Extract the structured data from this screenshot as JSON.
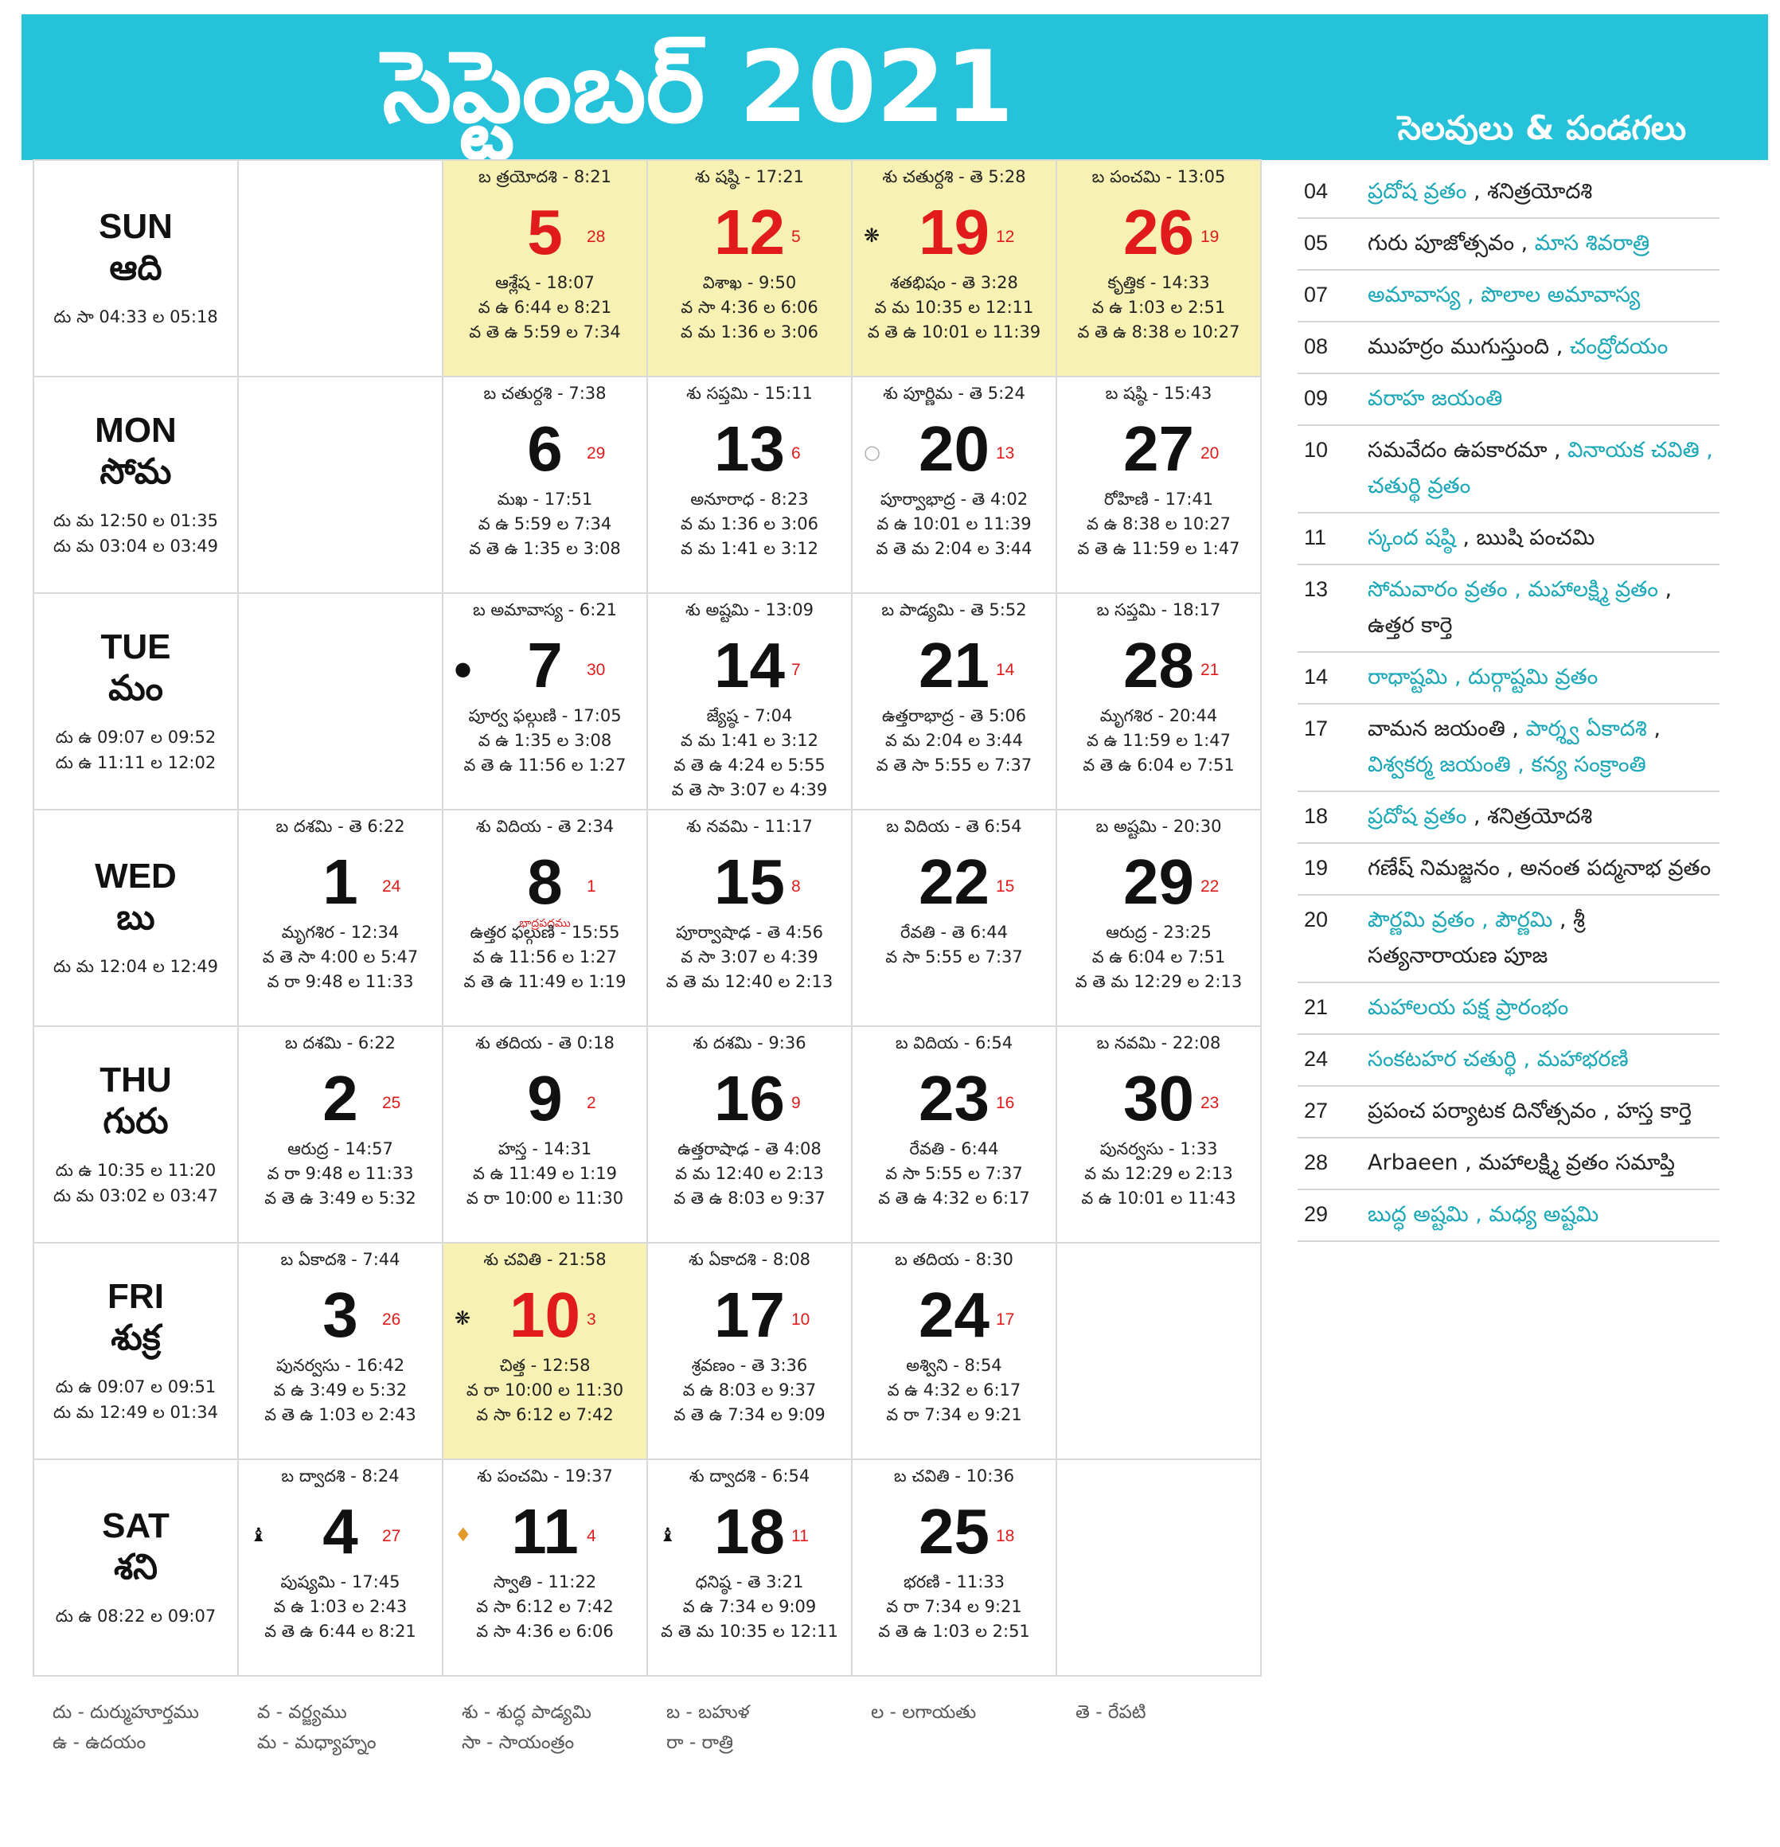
{
  "header": {
    "title": "సెప్టెంబర్ 2021",
    "subtitle": "సెలవులు & పండగలు"
  },
  "weekdays": [
    {
      "en": "SUN",
      "te": "ఆది",
      "durmuhurtham": [
        "దు సా 04:33 ల 05:18"
      ]
    },
    {
      "en": "MON",
      "te": "సోమ",
      "durmuhurtham": [
        "దు మ 12:50 ల 01:35",
        "దు మ 03:04 ల 03:49"
      ]
    },
    {
      "en": "TUE",
      "te": "మం",
      "durmuhurtham": [
        "దు ఉ 09:07 ల 09:52",
        "దు ఉ 11:11 ల 12:02"
      ]
    },
    {
      "en": "WED",
      "te": "బు",
      "durmuhurtham": [
        "దు మ 12:04 ల 12:49"
      ]
    },
    {
      "en": "THU",
      "te": "గురు",
      "durmuhurtham": [
        "దు ఉ 10:35 ల 11:20",
        "దు మ 03:02 ల 03:47"
      ]
    },
    {
      "en": "FRI",
      "te": "శుక్ర",
      "durmuhurtham": [
        "దు ఉ 09:07 ల 09:51",
        "దు మ 12:49 ల 01:34"
      ]
    },
    {
      "en": "SAT",
      "te": "శని",
      "durmuhurtham": [
        "దు ఉ 08:22 ల 09:07"
      ]
    }
  ],
  "days": [
    {
      "day": "1",
      "sub": "24",
      "tithi": "బ దశమి - తె 6:22",
      "lines": [
        "మృగశిర - 12:34",
        "వ తె సా 4:00 ల 5:47",
        "వ రా 9:48 ల 11:33"
      ]
    },
    {
      "day": "2",
      "sub": "25",
      "tithi": "బ దశమి - 6:22",
      "lines": [
        "ఆరుద్ర - 14:57",
        "వ రా 9:48 ల 11:33",
        "వ తె ఉ 3:49 ల 5:32"
      ]
    },
    {
      "day": "3",
      "sub": "26",
      "tithi": "బ ఏకాదశి - 7:44",
      "lines": [
        "పునర్వసు - 16:42",
        "వ ఉ 3:49 ల 5:32",
        "వ తె ఉ 1:03 ల 2:43"
      ]
    },
    {
      "day": "4",
      "sub": "27",
      "tithi": "బ ద్వాదశి - 8:24",
      "lines": [
        "పుష్యమి - 17:45",
        "వ ఉ 1:03 ల 2:43",
        "వ తె ఉ 6:44 ల 8:21"
      ],
      "symbol": "♝"
    },
    {
      "day": "5",
      "sub": "28",
      "tithi": "బ త్రయోదశి - 8:21",
      "lines": [
        "ఆశ్లేష - 18:07",
        "వ ఉ 6:44 ల 8:21",
        "వ తె ఉ 5:59 ల 7:34"
      ]
    },
    {
      "day": "6",
      "sub": "29",
      "tithi": "బ చతుర్దశి - 7:38",
      "lines": [
        "మఖ - 17:51",
        "వ ఉ 5:59 ల 7:34",
        "వ తె ఉ 1:35 ల 3:08"
      ]
    },
    {
      "day": "7",
      "sub": "30",
      "tithi": "బ అమావాస్య - 6:21",
      "lines": [
        "పూర్వ ఫల్గుణి - 17:05",
        "వ ఉ 1:35 ల 3:08",
        "వ తె ఉ 11:56 ల 1:27"
      ],
      "symbol": "●"
    },
    {
      "day": "8",
      "sub": "1",
      "tithi": "శు విదియ - తె 2:34",
      "note": "భాద్రపదము",
      "lines": [
        "ఉత్తర ఫల్గుణి - 15:55",
        "వ ఉ 11:56 ల 1:27",
        "వ తె ఉ 11:49 ల 1:19"
      ]
    },
    {
      "day": "9",
      "sub": "2",
      "tithi": "శు తదియ - తె 0:18",
      "lines": [
        "హస్త - 14:31",
        "వ ఉ 11:49 ల 1:19",
        "వ రా 10:00 ల 11:30"
      ]
    },
    {
      "day": "10",
      "sub": "3",
      "tithi": "శు చవితి - 21:58",
      "lines": [
        "చిత్త - 12:58",
        "వ రా 10:00 ల 11:30",
        "వ సా 6:12 ల 7:42"
      ],
      "symbol": "❋"
    },
    {
      "day": "11",
      "sub": "4",
      "tithi": "శు పంచమి - 19:37",
      "lines": [
        "స్వాతి - 11:22",
        "వ సా 6:12 ల 7:42",
        "వ సా 4:36 ల 6:06"
      ],
      "symbol": "♦"
    },
    {
      "day": "12",
      "sub": "5",
      "tithi": "శు షష్ఠి - 17:21",
      "lines": [
        "విశాఖ - 9:50",
        "వ సా 4:36 ల 6:06",
        "వ మ 1:36 ల 3:06"
      ]
    },
    {
      "day": "13",
      "sub": "6",
      "tithi": "శు సప్తమి - 15:11",
      "lines": [
        "అనూరాధ - 8:23",
        "వ మ 1:36 ల 3:06",
        "వ మ 1:41 ల 3:12"
      ]
    },
    {
      "day": "14",
      "sub": "7",
      "tithi": "శు అష్టమి - 13:09",
      "lines": [
        "జ్యేష్ఠ - 7:04",
        "వ మ 1:41 ల 3:12",
        "వ తె ఉ 4:24 ల 5:55",
        "వ తె సా 3:07 ల 4:39"
      ]
    },
    {
      "day": "15",
      "sub": "8",
      "tithi": "శు నవమి - 11:17",
      "lines": [
        "పూర్వాషాఢ - తె 4:56",
        "వ సా 3:07 ల 4:39",
        "వ తె మ 12:40 ల 2:13"
      ]
    },
    {
      "day": "16",
      "sub": "9",
      "tithi": "శు దశమి - 9:36",
      "lines": [
        "ఉత్తరాషాఢ - తె 4:08",
        "వ మ 12:40 ల 2:13",
        "వ తె ఉ 8:03 ల 9:37"
      ]
    },
    {
      "day": "17",
      "sub": "10",
      "tithi": "శు ఏకాదశి - 8:08",
      "lines": [
        "శ్రవణం - తె 3:36",
        "వ ఉ 8:03 ల 9:37",
        "వ తె ఉ 7:34 ల 9:09"
      ]
    },
    {
      "day": "18",
      "sub": "11",
      "tithi": "శు ద్వాదశి - 6:54",
      "lines": [
        "ధనిష్ఠ - తె 3:21",
        "వ ఉ 7:34 ల 9:09",
        "వ తె మ 10:35 ల 12:11"
      ],
      "symbol": "♝"
    },
    {
      "day": "19",
      "sub": "12",
      "tithi": "శు చతుర్దశి - తె 5:28",
      "lines": [
        "శతభిషం - తె 3:28",
        "వ మ 10:35 ల 12:11",
        "వ తె ఉ 10:01 ల 11:39"
      ],
      "symbol": "❋"
    },
    {
      "day": "20",
      "sub": "13",
      "tithi": "శు పూర్ణిమ - తె 5:24",
      "lines": [
        "పూర్వాభాద్ర - తె 4:02",
        "వ ఉ 10:01 ల 11:39",
        "వ తె మ 2:04 ల 3:44"
      ],
      "symbol": "○"
    },
    {
      "day": "21",
      "sub": "14",
      "tithi": "బ పాడ్యమి - తె 5:52",
      "lines": [
        "ఉత్తరాభాద్ర - తె 5:06",
        "వ మ 2:04 ల 3:44",
        "వ తె సా 5:55 ల 7:37"
      ]
    },
    {
      "day": "22",
      "sub": "15",
      "tithi": "బ విదియ - తె 6:54",
      "lines": [
        "రేవతి - తె 6:44",
        "వ సా 5:55 ల 7:37"
      ]
    },
    {
      "day": "23",
      "sub": "16",
      "tithi": "బ విదియ - 6:54",
      "lines": [
        "రేవతి - 6:44",
        "వ సా 5:55 ల 7:37",
        "వ తె ఉ 4:32 ల 6:17"
      ]
    },
    {
      "day": "24",
      "sub": "17",
      "tithi": "బ తదియ - 8:30",
      "lines": [
        "అశ్విని - 8:54",
        "వ ఉ 4:32 ల 6:17",
        "వ రా 7:34 ల 9:21"
      ]
    },
    {
      "day": "25",
      "sub": "18",
      "tithi": "బ చవితి - 10:36",
      "lines": [
        "భరణి - 11:33",
        "వ రా 7:34 ల 9:21",
        "వ తె ఉ 1:03 ల 2:51"
      ]
    },
    {
      "day": "26",
      "sub": "19",
      "tithi": "బ పంచమి - 13:05",
      "lines": [
        "కృత్తిక - 14:33",
        "వ ఉ 1:03 ల 2:51",
        "వ తె ఉ 8:38 ల 10:27"
      ]
    },
    {
      "day": "27",
      "sub": "20",
      "tithi": "బ షష్ఠి - 15:43",
      "lines": [
        "రోహిణి - 17:41",
        "వ ఉ 8:38 ల 10:27",
        "వ తె ఉ 11:59 ల 1:47"
      ]
    },
    {
      "day": "28",
      "sub": "21",
      "tithi": "బ సప్తమి - 18:17",
      "lines": [
        "మృగశిర - 20:44",
        "వ ఉ 11:59 ల 1:47",
        "వ తె ఉ 6:04 ల 7:51"
      ]
    },
    {
      "day": "29",
      "sub": "22",
      "tithi": "బ అష్టమి - 20:30",
      "lines": [
        "ఆరుద్ర - 23:25",
        "వ ఉ 6:04 ల 7:51",
        "వ తె మ 12:29 ల 2:13"
      ]
    },
    {
      "day": "30",
      "sub": "23",
      "tithi": "బ నవమి - 22:08",
      "lines": [
        "పునర్వసు - 1:33",
        "వ మ 12:29 ల 2:13",
        "వ ఉ 10:01 ల 11:43"
      ]
    }
  ],
  "legend": [
    [
      "దు - దుర్ముహూర్తము",
      "ఉ - ఉదయం"
    ],
    [
      "వ - వర్జ్యము",
      "మ - మధ్యాహ్నం"
    ],
    [
      "శు - శుద్ధ పాడ్యమి",
      "సా - సాయంత్రం"
    ],
    [
      "బ - బహుళ",
      "రా - రాత్రి"
    ],
    [
      "ల - లగాయతు"
    ],
    [
      "తె - రేపటి"
    ]
  ],
  "holidays": [
    {
      "date": "04",
      "parts": [
        {
          "t": "ప్రదోష వ్రతం",
          "teal": true
        },
        {
          "t": " , శనిత్రయోదశి",
          "teal": false
        }
      ]
    },
    {
      "date": "05",
      "parts": [
        {
          "t": "గురు పూజోత్సవం , ",
          "teal": false
        },
        {
          "t": "మాస శివరాత్రి",
          "teal": true
        }
      ]
    },
    {
      "date": "07",
      "parts": [
        {
          "t": "అమావాస్య , పొలాల అమావాస్య",
          "teal": true
        }
      ]
    },
    {
      "date": "08",
      "parts": [
        {
          "t": "ముహర్రం ముగుస్తుంది , ",
          "teal": false
        },
        {
          "t": "చంద్రోదయం",
          "teal": true
        }
      ]
    },
    {
      "date": "09",
      "parts": [
        {
          "t": "వరాహ జయంతి",
          "teal": true
        }
      ]
    },
    {
      "date": "10",
      "parts": [
        {
          "t": "సమవేదం ఉపకారమా , ",
          "teal": false
        },
        {
          "t": "వినాయక చవితి , చతుర్థి వ్రతం",
          "teal": true
        }
      ]
    },
    {
      "date": "11",
      "parts": [
        {
          "t": "స్కంద షష్ఠి",
          "teal": true
        },
        {
          "t": " , ఋషి పంచమి",
          "teal": false
        }
      ]
    },
    {
      "date": "13",
      "parts": [
        {
          "t": "సోమవారం వ్రతం , మహాలక్ష్మి వ్రతం",
          "teal": true
        },
        {
          "t": " , ఉత్తర కార్తె",
          "teal": false
        }
      ]
    },
    {
      "date": "14",
      "parts": [
        {
          "t": "రాధాష్టమి , దుర్గాష్టమి వ్రతం",
          "teal": true
        }
      ]
    },
    {
      "date": "17",
      "parts": [
        {
          "t": "వామన జయంతి , ",
          "teal": false
        },
        {
          "t": "పార్శ్వ ఏకాదశి",
          "teal": true
        },
        {
          "t": " , ",
          "teal": false
        },
        {
          "t": "విశ్వకర్మ జయంతి , కన్య సంక్రాంతి",
          "teal": true
        }
      ]
    },
    {
      "date": "18",
      "parts": [
        {
          "t": "ప్రదోష వ్రతం",
          "teal": true
        },
        {
          "t": " , శనిత్రయోదశి",
          "teal": false
        }
      ]
    },
    {
      "date": "19",
      "parts": [
        {
          "t": "గణేష్ నిమజ్జనం , అనంత పద్మనాభ వ్రతం",
          "teal": false
        }
      ]
    },
    {
      "date": "20",
      "parts": [
        {
          "t": "పౌర్ణమి వ్రతం , పౌర్ణమి",
          "teal": true
        },
        {
          "t": " , శ్రీ సత్యనారాయణ పూజ",
          "teal": false
        }
      ]
    },
    {
      "date": "21",
      "parts": [
        {
          "t": "మహాలయ పక్ష ప్రారంభం",
          "teal": true
        }
      ]
    },
    {
      "date": "24",
      "parts": [
        {
          "t": "సంకటహర చతుర్థి , మహాభరణి",
          "teal": true
        }
      ]
    },
    {
      "date": "27",
      "parts": [
        {
          "t": "ప్రపంచ పర్యాటక దినోత్సవం , హస్త కార్తె",
          "teal": false
        }
      ]
    },
    {
      "date": "28",
      "parts": [
        {
          "t": "Arbaeen , మహాలక్ష్మి వ్రతం సమాప్తి",
          "teal": false
        }
      ]
    },
    {
      "date": "29",
      "parts": [
        {
          "t": "బుద్ధ అష్టమి , మధ్య అష్టమి",
          "teal": true
        }
      ]
    }
  ],
  "colors": {
    "banner": "#26c2d9",
    "highlight": "#f7f1b4",
    "red": "#e11b1b",
    "teal": "#1aa7b8"
  }
}
